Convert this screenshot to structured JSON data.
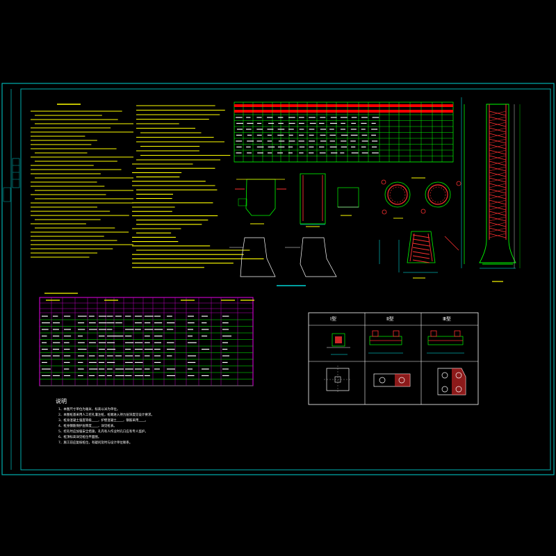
{
  "colors": {
    "background": "#000000",
    "frame": "#00b0b0",
    "text_primary": "#ffff00",
    "text_secondary": "#ffffff",
    "table_header": "#ff0000",
    "grid": "#00ff00",
    "magenta_frame": "#c000c0",
    "rebar": "#ff3030",
    "concrete": "#00ff00",
    "dimension": "#00ffff"
  },
  "notes": {
    "title": "说明",
    "items": [
      "1、本图尺寸单位为毫米，标高以米为单位。",
      "2、本图桩基采用人工挖孔灌注桩，桩端进入持力层深度见设计要求。",
      "3、桩身混凝土强度等级____，护壁混凝土____，钢筋采用____。",
      "4、桩身钢筋保护层厚度____，详见桩表。",
      "5、挖孔时应加强安全措施，孔内有人作业时孔口应有专人监护。",
      "6、桩顶标高详见桩位平面图。",
      "7、施工前应复核桩位，有疑问及时与设计单位联系。"
    ]
  },
  "pile_cap_types": {
    "labels": [
      "Ⅰ型",
      "Ⅱ型",
      "Ⅲ型"
    ]
  },
  "icons": [
    "frame-border",
    "title-strip",
    "section-detail",
    "plan-detail"
  ]
}
